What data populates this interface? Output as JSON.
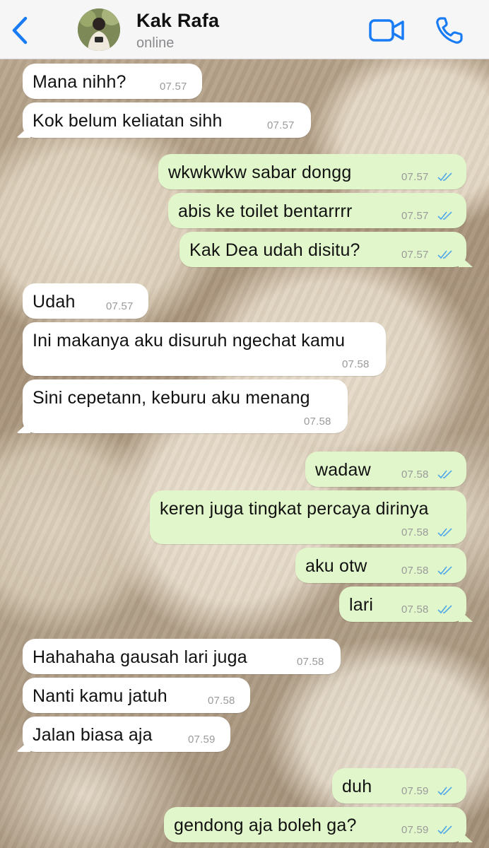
{
  "header": {
    "contact_name": "Kak Rafa",
    "status": "online"
  },
  "colors": {
    "accent": "#1a7cf5",
    "incoming_bubble": "#ffffff",
    "outgoing_bubble": "#e1f7cb",
    "read_tick": "#4fa6e8"
  },
  "messages": [
    {
      "dir": "in",
      "text": "Mana nihh?",
      "time": "07.57"
    },
    {
      "dir": "in",
      "text": "Kok belum keliatan sihh",
      "time": "07.57"
    },
    {
      "dir": "out",
      "text": "wkwkwkw sabar dongg",
      "time": "07.57",
      "status": "read"
    },
    {
      "dir": "out",
      "text": "abis ke toilet bentarrrr",
      "time": "07.57",
      "status": "read"
    },
    {
      "dir": "out",
      "text": "Kak Dea udah disitu?",
      "time": "07.57",
      "status": "read"
    },
    {
      "dir": "in",
      "text": "Udah",
      "time": "07.57"
    },
    {
      "dir": "in",
      "text": "Ini makanya aku disuruh ngechat kamu",
      "time": "07.58"
    },
    {
      "dir": "in",
      "text": "Sini cepetann, keburu aku menang",
      "time": "07.58"
    },
    {
      "dir": "out",
      "text": "wadaw",
      "time": "07.58",
      "status": "read"
    },
    {
      "dir": "out",
      "text": "keren juga tingkat percaya dirinya",
      "time": "07.58",
      "status": "read"
    },
    {
      "dir": "out",
      "text": "aku otw",
      "time": "07.58",
      "status": "read"
    },
    {
      "dir": "out",
      "text": "lari",
      "time": "07.58",
      "status": "read"
    },
    {
      "dir": "in",
      "text": "Hahahaha gausah lari juga",
      "time": "07.58"
    },
    {
      "dir": "in",
      "text": "Nanti kamu jatuh",
      "time": "07.58"
    },
    {
      "dir": "in",
      "text": "Jalan biasa aja",
      "time": "07.59"
    },
    {
      "dir": "out",
      "text": "duh",
      "time": "07.59",
      "status": "read"
    },
    {
      "dir": "out",
      "text": "gendong aja boleh ga?",
      "time": "07.59",
      "status": "read"
    }
  ]
}
